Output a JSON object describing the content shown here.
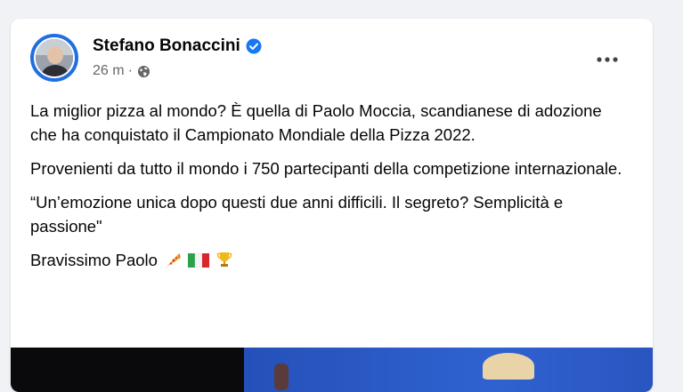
{
  "post": {
    "author": "Stefano Bonaccini",
    "time": "26 m",
    "separator": "·",
    "paragraphs": [
      "La miglior pizza al mondo? È quella di Paolo Moccia, scandianese di adozione che ha conquistato il Campionato Mondiale della Pizza 2022.",
      "Provenienti da tutto il mondo i 750 partecipanti della competizione internazionale.",
      "“Un’emozione unica dopo questi due anni difficili. Il segreto? Semplicità e passione\""
    ],
    "closing": "Bravissimo Paolo",
    "closing_emojis": [
      "pizza-icon",
      "italy-flag-icon",
      "trophy-icon"
    ]
  },
  "icons": {
    "verified": "verified-badge-icon",
    "privacy": "globe-icon",
    "menu": "more-options-icon"
  },
  "colors": {
    "background": "#f0f2f5",
    "card": "#ffffff",
    "text": "#050505",
    "secondary_text": "#65676b",
    "verified_blue": "#1877f2"
  }
}
